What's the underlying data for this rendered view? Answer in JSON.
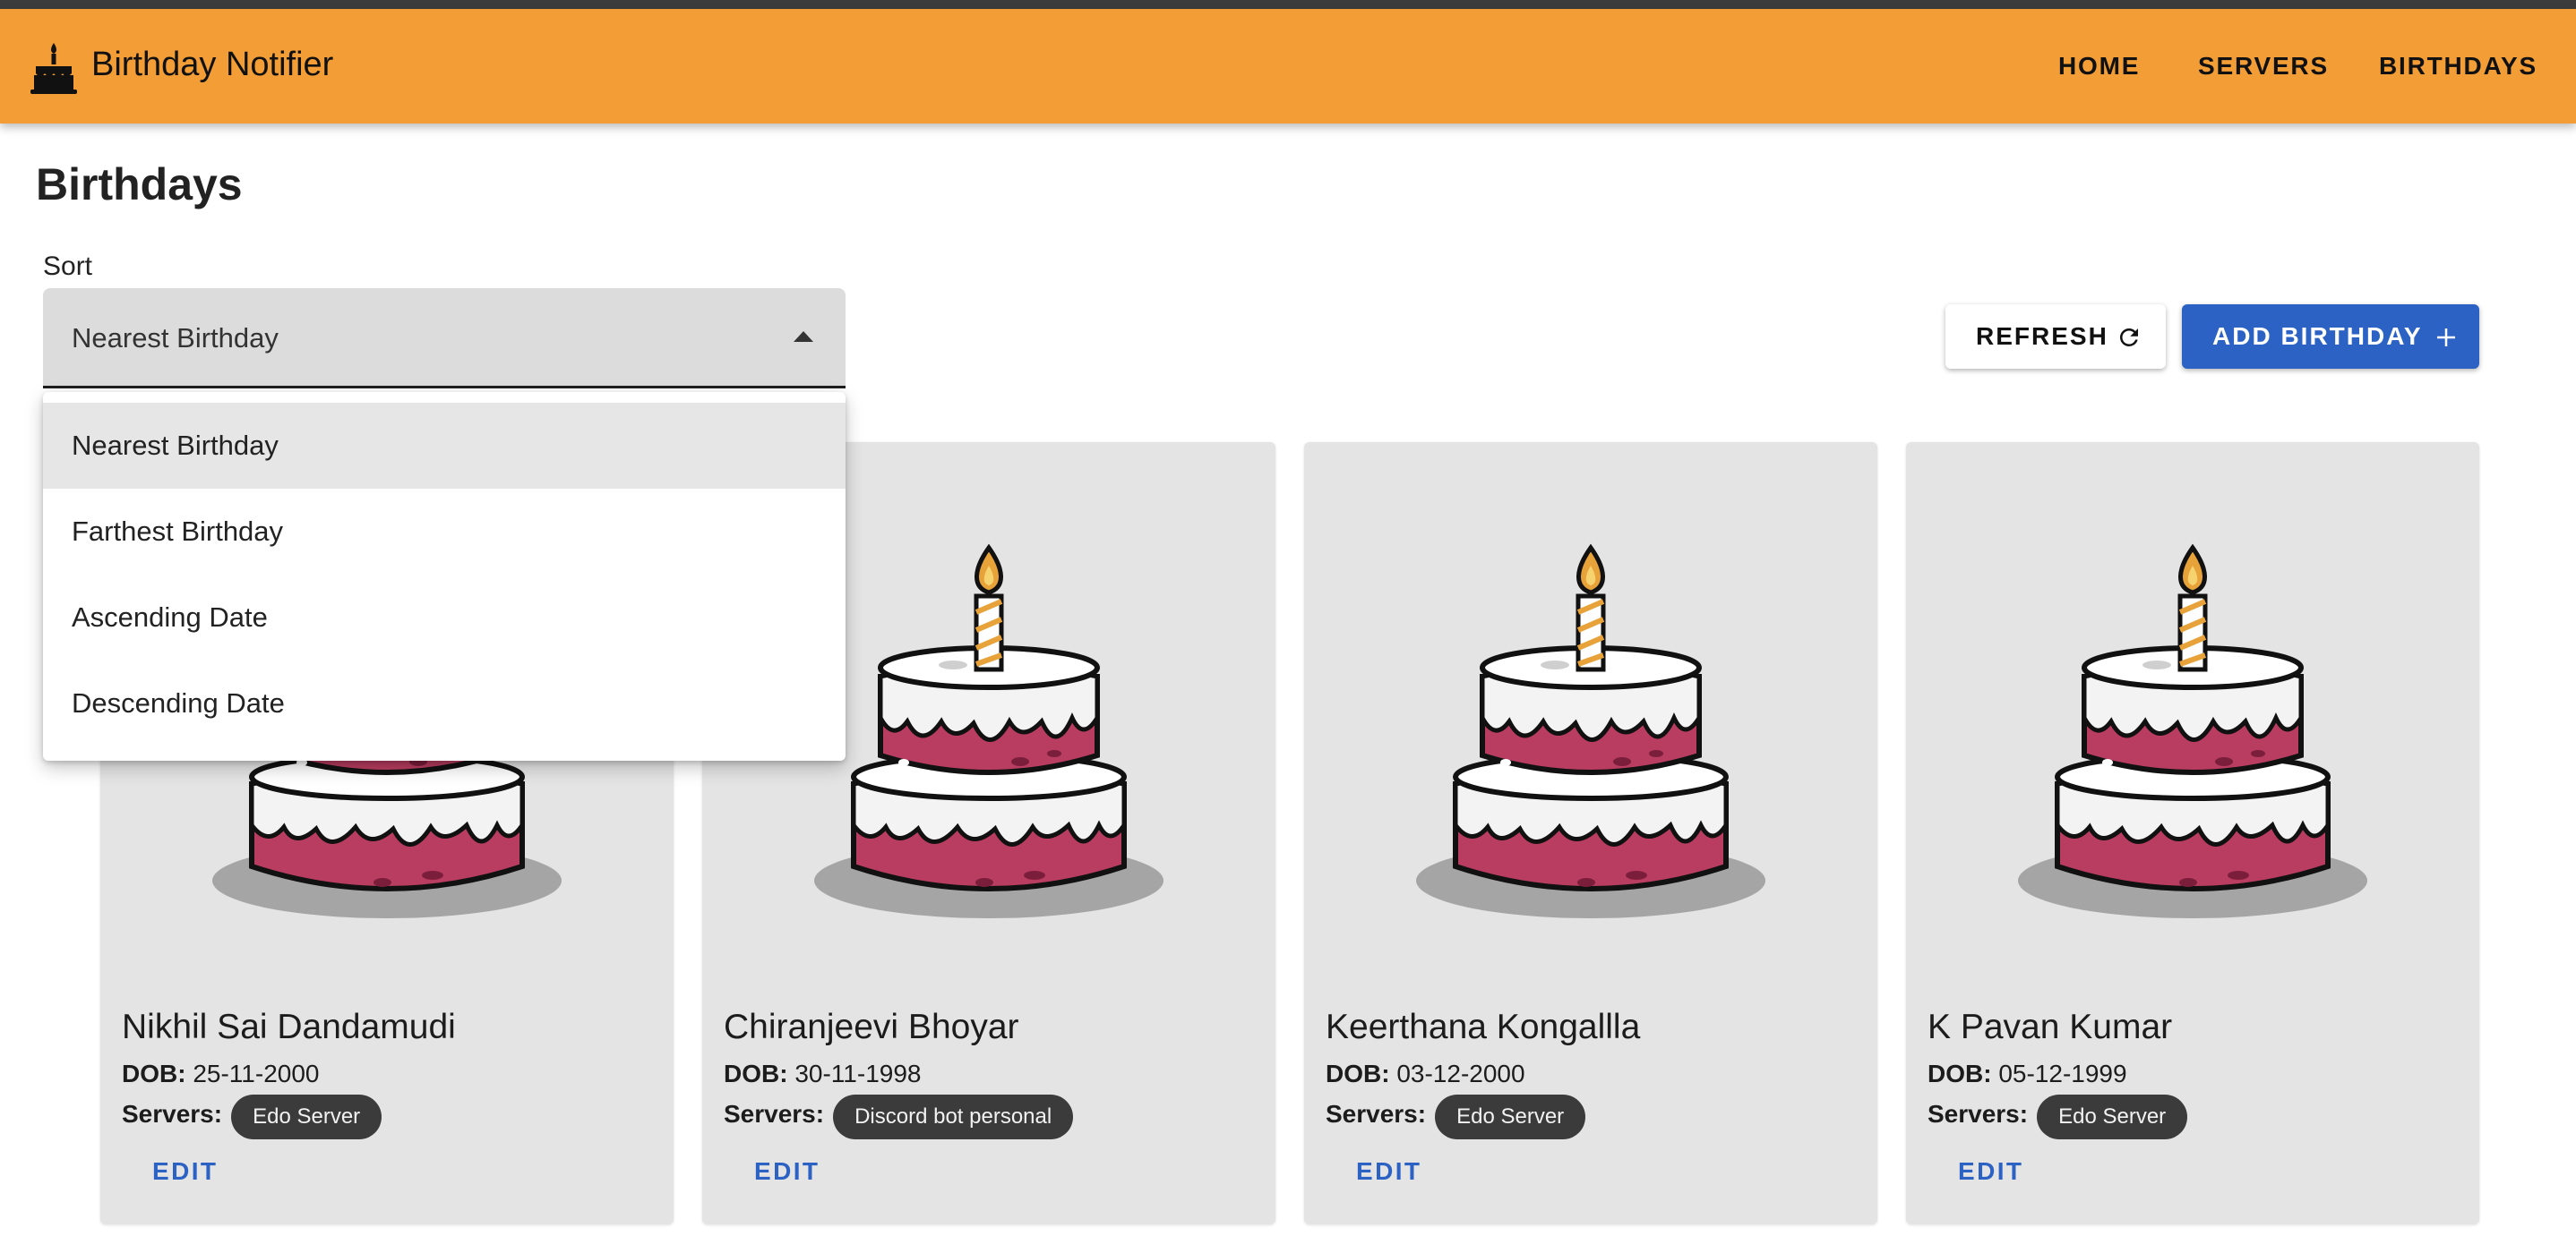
{
  "app": {
    "title": "Birthday Notifier",
    "icon": "cake-icon",
    "accent_color": "#f29d36",
    "primary_color": "#2b62c4"
  },
  "nav": {
    "items": [
      {
        "label": "HOME"
      },
      {
        "label": "SERVERS"
      },
      {
        "label": "BIRTHDAYS"
      }
    ]
  },
  "page": {
    "title": "Birthdays"
  },
  "sort": {
    "label": "Sort",
    "selected": "Nearest Birthday",
    "expanded": true,
    "options": [
      {
        "label": "Nearest Birthday"
      },
      {
        "label": "Farthest Birthday"
      },
      {
        "label": "Ascending Date"
      },
      {
        "label": "Descending Date"
      }
    ]
  },
  "actions": {
    "refresh_label": "REFRESH",
    "refresh_icon": "refresh-icon",
    "add_label": "ADD BIRTHDAY",
    "add_icon": "plus-icon"
  },
  "cards": [
    {
      "name": "Nikhil Sai Dandamudi",
      "dob_label": "DOB:",
      "dob": "25-11-2000",
      "servers_label": "Servers:",
      "servers": [
        "Edo Server"
      ],
      "edit_label": "EDIT"
    },
    {
      "name": "Chiranjeevi Bhoyar",
      "dob_label": "DOB:",
      "dob": "30-11-1998",
      "servers_label": "Servers:",
      "servers": [
        "Discord bot personal"
      ],
      "edit_label": "EDIT"
    },
    {
      "name": "Keerthana Kongallla",
      "dob_label": "DOB:",
      "dob": "03-12-2000",
      "servers_label": "Servers:",
      "servers": [
        "Edo Server"
      ],
      "edit_label": "EDIT"
    },
    {
      "name": "K Pavan Kumar",
      "dob_label": "DOB:",
      "dob": "05-12-1999",
      "servers_label": "Servers:",
      "servers": [
        "Edo Server"
      ],
      "edit_label": "EDIT"
    }
  ]
}
